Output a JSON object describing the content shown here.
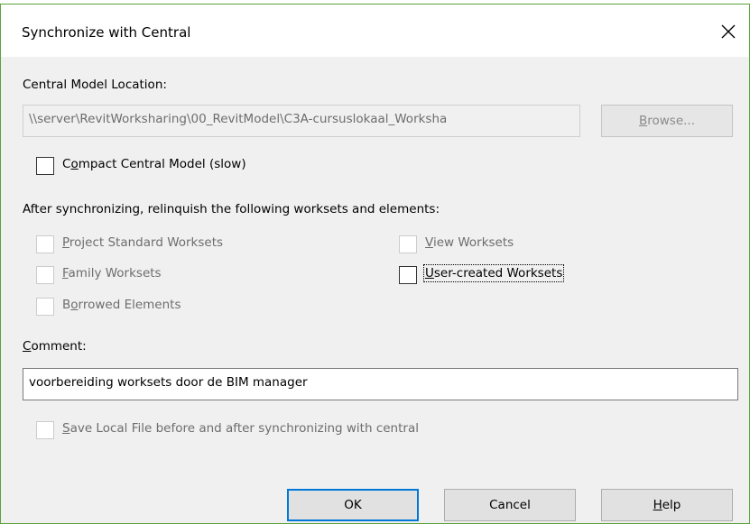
{
  "dialog": {
    "title": "Synchronize with Central",
    "close_icon": "close-icon"
  },
  "central_model": {
    "label": "Central Model Location:",
    "path": "\\\\server\\RevitWorksharing\\00_RevitModel\\C3A-cursuslokaal_Worksha",
    "browse_label_pre": "",
    "browse_label_key": "B",
    "browse_label_post": "rowse..."
  },
  "compact": {
    "label_pre": "C",
    "label_key": "o",
    "label_post": "mpact Central Model (slow)",
    "checked": false
  },
  "relinquish": {
    "heading": "After synchronizing, relinquish the following worksets and elements:",
    "options": [
      {
        "pre": "",
        "key": "P",
        "post": "roject Standard Worksets",
        "enabled": false,
        "checked": false
      },
      {
        "pre": "",
        "key": "F",
        "post": "amily Worksets",
        "enabled": false,
        "checked": false
      },
      {
        "pre": "B",
        "key": "o",
        "post": "rrowed Elements",
        "enabled": false,
        "checked": false
      },
      {
        "pre": "",
        "key": "V",
        "post": "iew Worksets",
        "enabled": false,
        "checked": false
      },
      {
        "pre": "",
        "key": "U",
        "post": "ser-created Worksets",
        "enabled": true,
        "checked": false
      }
    ]
  },
  "comment": {
    "label_pre": "",
    "label_key": "C",
    "label_post": "omment:",
    "value": "voorbereiding worksets door de BIM manager"
  },
  "save_local": {
    "label_pre": "",
    "label_key": "S",
    "label_post": "ave Local File before and after synchronizing with central",
    "enabled": false,
    "checked": false
  },
  "buttons": {
    "ok": "OK",
    "cancel": "Cancel",
    "help_key": "H",
    "help_post": "elp"
  }
}
